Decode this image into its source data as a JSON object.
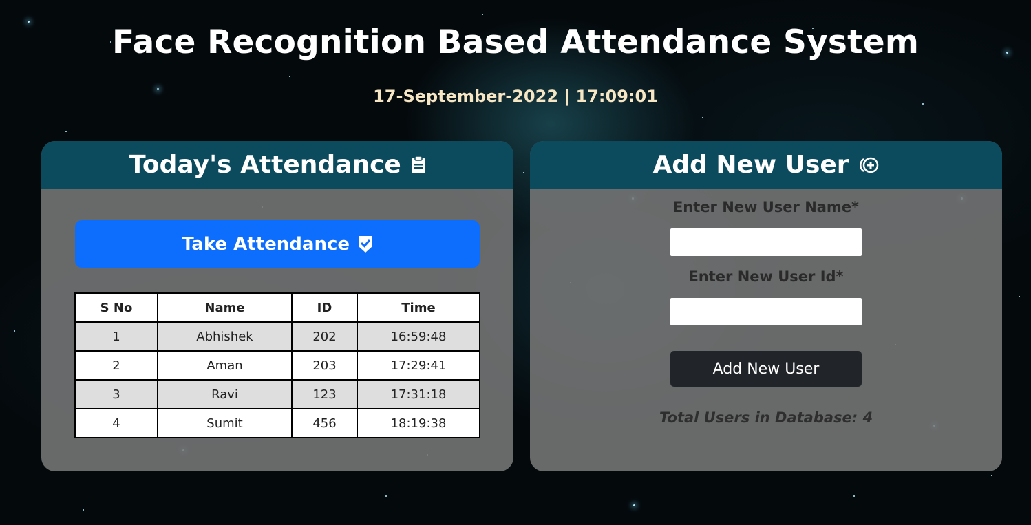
{
  "header": {
    "title": "Face Recognition Based Attendance System",
    "datetime": "17-September-2022 | 17:09:01"
  },
  "attendance": {
    "title": "Today's Attendance",
    "icon": "clipboard-icon",
    "take_button": "Take Attendance",
    "take_button_icon": "check-shield-icon",
    "columns": [
      "S No",
      "Name",
      "ID",
      "Time"
    ],
    "rows": [
      [
        "1",
        "Abhishek",
        "202",
        "16:59:48"
      ],
      [
        "2",
        "Aman",
        "203",
        "17:29:41"
      ],
      [
        "3",
        "Ravi",
        "123",
        "17:31:18"
      ],
      [
        "4",
        "Sumit",
        "456",
        "18:19:38"
      ]
    ]
  },
  "add_user": {
    "title": "Add New User",
    "icon": "add-circle-icon",
    "name_label": "Enter New User Name*",
    "name_value": "",
    "id_label": "Enter New User Id*",
    "id_value": "",
    "button": "Add New User",
    "total_text": "Total Users in Database: 4"
  },
  "colors": {
    "header_bg": "#0c4b5e",
    "primary_button": "#0d6efd",
    "dark_button": "#212529",
    "card_bg": "#767676",
    "datetime_text": "#f6e6c4"
  }
}
